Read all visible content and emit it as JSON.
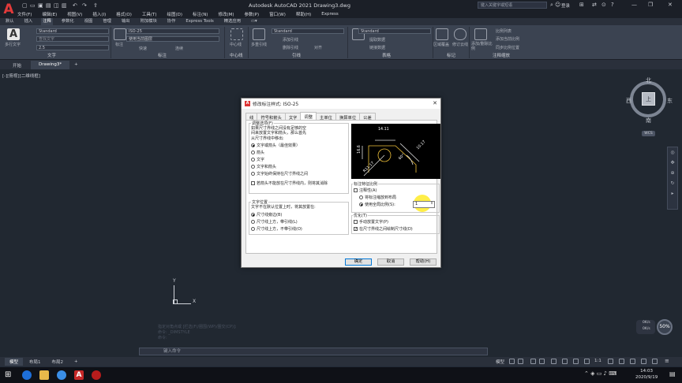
{
  "app": {
    "title": "Autodesk AutoCAD 2021    Drawing3.dwg",
    "search_placeholder": "键入关键字或短语",
    "user": "登录",
    "icons": [
      "autocad-logo-icon",
      "new-icon",
      "open-icon",
      "save-icon",
      "saveas-icon",
      "print-icon",
      "undo-icon",
      "redo-icon",
      "share-icon"
    ]
  },
  "menubar": [
    "文件(F)",
    "编辑(E)",
    "视图(V)",
    "插入(I)",
    "格式(O)",
    "工具(T)",
    "绘图(D)",
    "标注(N)",
    "修改(M)",
    "参数(P)",
    "窗口(W)",
    "帮助(H)",
    "Express"
  ],
  "ribbon_tabs": [
    "默认",
    "插入",
    "注释",
    "参数化",
    "视图",
    "管理",
    "输出",
    "附加模块",
    "协作",
    "Express Tools",
    "精选应用"
  ],
  "ribbon_active_tab": "注释",
  "ribbon": {
    "text_panel": {
      "title": "文字",
      "big_button": "多行文字",
      "style": "Standard",
      "height": "2.5",
      "find": "查找文字"
    },
    "dim_panel": {
      "title": "标注",
      "big_button": "标注",
      "style": "ISO-25",
      "layer": "使用当前图层",
      "continue": "快速",
      "extra": "连续"
    },
    "centerline_panel": {
      "title": "中心线",
      "big_button": "中心线"
    },
    "leader_panel": {
      "title": "引线",
      "big_button": "多重引线",
      "style": "Standard",
      "add": "添加引线",
      "remove": "删除引线",
      "align": "对齐"
    },
    "table_panel": {
      "title": "表格",
      "big_button": "表格",
      "style": "Standard",
      "a": "提取数据",
      "b": "链接数据"
    },
    "markup_panel": {
      "title": "标记",
      "a": "区域覆盖",
      "b": "修订云线"
    },
    "scale_panel": {
      "title": "注释缩放",
      "big_button": "添加/删除比例",
      "a": "比例列表",
      "b": "添加当前比例",
      "c": "同步比例位置"
    }
  },
  "doc_tabs": [
    "开始",
    "Drawing3*"
  ],
  "doc_tab_active": "Drawing3*",
  "view_label": "[-][俯视][二维线框]",
  "viewcube": {
    "top": "上",
    "north": "北",
    "south": "南",
    "east": "东",
    "west": "西",
    "wcs": "WCS"
  },
  "ucs": {
    "x": "X",
    "y": "Y"
  },
  "command": {
    "placeholder": "键入命令",
    "history": [
      "指定对角点或 [栏选(F)/圈围(WP)/圈交(CP)]:",
      "命令: _DIMSTYLE",
      "命令:"
    ]
  },
  "layout_tabs": [
    "模型",
    "布局1",
    "布局2"
  ],
  "layout_active": "模型",
  "status": {
    "model": "模型",
    "zoom": "50%",
    "scale": "1:1",
    "speed1": "0K/s",
    "speed2": "0K/s"
  },
  "taskbar": {
    "time": "14:03",
    "date": "2020/9/19"
  },
  "dialog": {
    "title": "修改标注样式: ISO-25",
    "tabs": [
      "线",
      "符号和箭头",
      "文字",
      "调整",
      "主单位",
      "换算单位",
      "公差"
    ],
    "active_tab": "调整",
    "fit_group": {
      "label": "调整选项(F)",
      "desc": [
        "如果尺寸界线之间没有足够的空",
        "间来放置文字和箭头，那么首先",
        "从尺寸界线中移出:"
      ],
      "options": [
        "文字或箭头（最佳效果）",
        "箭头",
        "文字",
        "文字和箭头",
        "文字始终保持在尺寸界线之间"
      ],
      "selected_index": 0,
      "suppress": "若箭头不能放在尺寸界线内，则将其消除"
    },
    "text_pos_group": {
      "label": "文字位置",
      "desc": "文字不在默认位置上时，将其放置在:",
      "options": [
        "尺寸线旁边(B)",
        "尺寸线上方，带引线(L)",
        "尺寸线上方，不带引线(O)"
      ],
      "selected_index": 0
    },
    "scale_group": {
      "label": "标注特征比例",
      "annotative": "注释性(A)",
      "layout": "将标注缩放到布局",
      "global": "使用全局比例(S):",
      "global_value": "1"
    },
    "fine_group": {
      "label": "优化(T)",
      "manual": "手动放置文字(P)",
      "draw_dim": "在尺寸界线之间绘制尺寸线(D)"
    },
    "preview_dims": [
      "14.11",
      "16.6",
      "10.17",
      "R11.17",
      "60°"
    ],
    "buttons": {
      "ok": "确定",
      "cancel": "取消",
      "help": "帮助(H)"
    }
  }
}
